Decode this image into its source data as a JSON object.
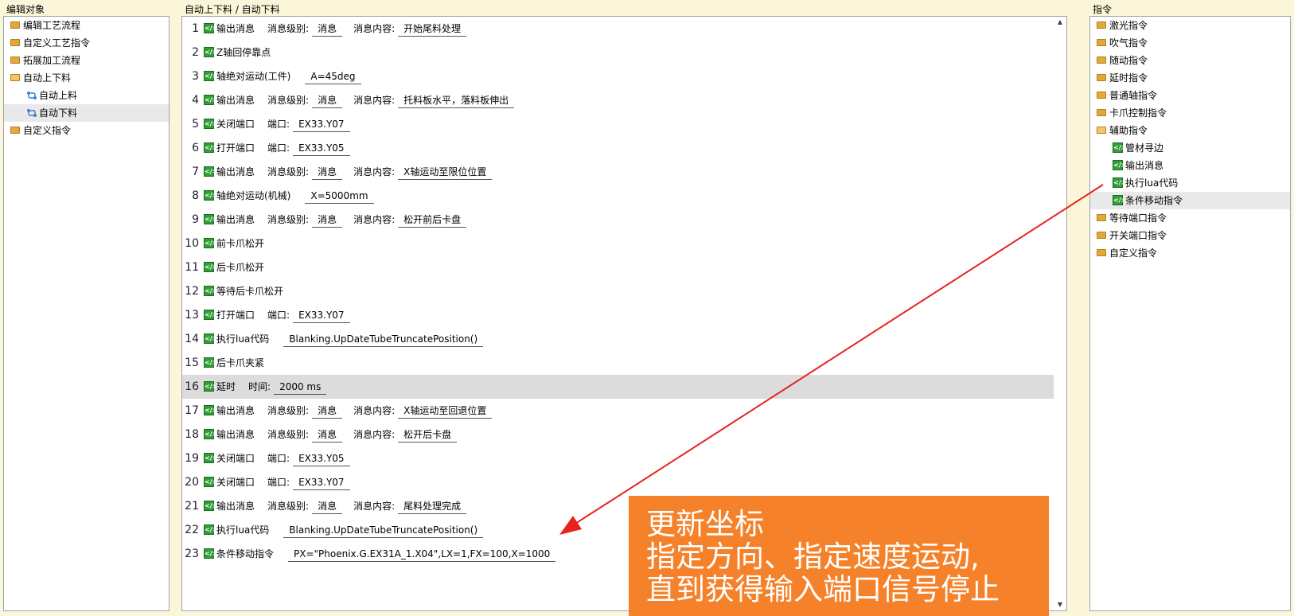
{
  "left_panel": {
    "title": "编辑对象",
    "items": [
      {
        "label": "编辑工艺流程"
      },
      {
        "label": "自定义工艺指令"
      },
      {
        "label": "拓展加工流程"
      },
      {
        "label": "自动上下料"
      },
      {
        "label": "自动上料"
      },
      {
        "label": "自动下料"
      },
      {
        "label": "自定义指令"
      }
    ]
  },
  "mid_panel": {
    "title": "自动上下料 / 自动下料",
    "lines": [
      {
        "n": "1",
        "cmd": "输出消息",
        "p1": "消息级别:",
        "v1": "消息",
        "p2": "消息内容:",
        "v2": "开始尾料处理"
      },
      {
        "n": "2",
        "cmd": "Z轴回停靠点"
      },
      {
        "n": "3",
        "cmd": "轴绝对运动(工件)",
        "v1": "A=45deg"
      },
      {
        "n": "4",
        "cmd": "输出消息",
        "p1": "消息级别:",
        "v1": "消息",
        "p2": "消息内容:",
        "v2": "托料板水平，落料板伸出"
      },
      {
        "n": "5",
        "cmd": "关闭端口",
        "p1": "端口:",
        "v1": "EX33.Y07"
      },
      {
        "n": "6",
        "cmd": "打开端口",
        "p1": "端口:",
        "v1": "EX33.Y05"
      },
      {
        "n": "7",
        "cmd": "输出消息",
        "p1": "消息级别:",
        "v1": "消息",
        "p2": "消息内容:",
        "v2": "X轴运动至限位位置"
      },
      {
        "n": "8",
        "cmd": "轴绝对运动(机械)",
        "v1": "X=5000mm"
      },
      {
        "n": "9",
        "cmd": "输出消息",
        "p1": "消息级别:",
        "v1": "消息",
        "p2": "消息内容:",
        "v2": "松开前后卡盘"
      },
      {
        "n": "10",
        "cmd": "前卡爪松开"
      },
      {
        "n": "11",
        "cmd": "后卡爪松开"
      },
      {
        "n": "12",
        "cmd": "等待后卡爪松开"
      },
      {
        "n": "13",
        "cmd": "打开端口",
        "p1": "端口:",
        "v1": "EX33.Y07"
      },
      {
        "n": "14",
        "cmd": "执行lua代码",
        "v1": "Blanking.UpDateTubeTruncatePosition()"
      },
      {
        "n": "15",
        "cmd": "后卡爪夹紧"
      },
      {
        "n": "16",
        "cmd": "延时",
        "p1": "时间:",
        "v1": "2000 ms"
      },
      {
        "n": "17",
        "cmd": "输出消息",
        "p1": "消息级别:",
        "v1": "消息",
        "p2": "消息内容:",
        "v2": "X轴运动至回退位置"
      },
      {
        "n": "18",
        "cmd": "输出消息",
        "p1": "消息级别:",
        "v1": "消息",
        "p2": "消息内容:",
        "v2": "松开后卡盘"
      },
      {
        "n": "19",
        "cmd": "关闭端口",
        "p1": "端口:",
        "v1": "EX33.Y05"
      },
      {
        "n": "20",
        "cmd": "关闭端口",
        "p1": "端口:",
        "v1": "EX33.Y07"
      },
      {
        "n": "21",
        "cmd": "输出消息",
        "p1": "消息级别:",
        "v1": "消息",
        "p2": "消息内容:",
        "v2": "尾料处理完成"
      },
      {
        "n": "22",
        "cmd": "执行lua代码",
        "v1": "Blanking.UpDateTubeTruncatePosition()"
      },
      {
        "n": "23",
        "cmd": "条件移动指令",
        "v1": "PX=\"Phoenix.G.EX31A_1.X04\",LX=1,FX=100,X=1000"
      }
    ],
    "scroll_up": "▲",
    "scroll_down": "▼"
  },
  "right_panel": {
    "title": "指令",
    "items": [
      {
        "label": "激光指令"
      },
      {
        "label": "吹气指令"
      },
      {
        "label": "随动指令"
      },
      {
        "label": "延时指令"
      },
      {
        "label": "普通轴指令"
      },
      {
        "label": "卡爪控制指令"
      },
      {
        "label": "辅助指令"
      },
      {
        "label": "管材寻边"
      },
      {
        "label": "输出消息"
      },
      {
        "label": "执行lua代码"
      },
      {
        "label": "条件移动指令"
      },
      {
        "label": "等待端口指令"
      },
      {
        "label": "开关端口指令"
      },
      {
        "label": "自定义指令"
      }
    ]
  },
  "callout": {
    "lines": [
      "更新坐标",
      "指定方向、指定速度运动,",
      "直到获得输入端口信号停止"
    ]
  },
  "colors": {
    "callout_bg": "#f5822a",
    "arrow": "#e8231c",
    "cmd_icon": "#2f9e34",
    "folder": "#e3a938",
    "background": "#fbf6d9"
  }
}
